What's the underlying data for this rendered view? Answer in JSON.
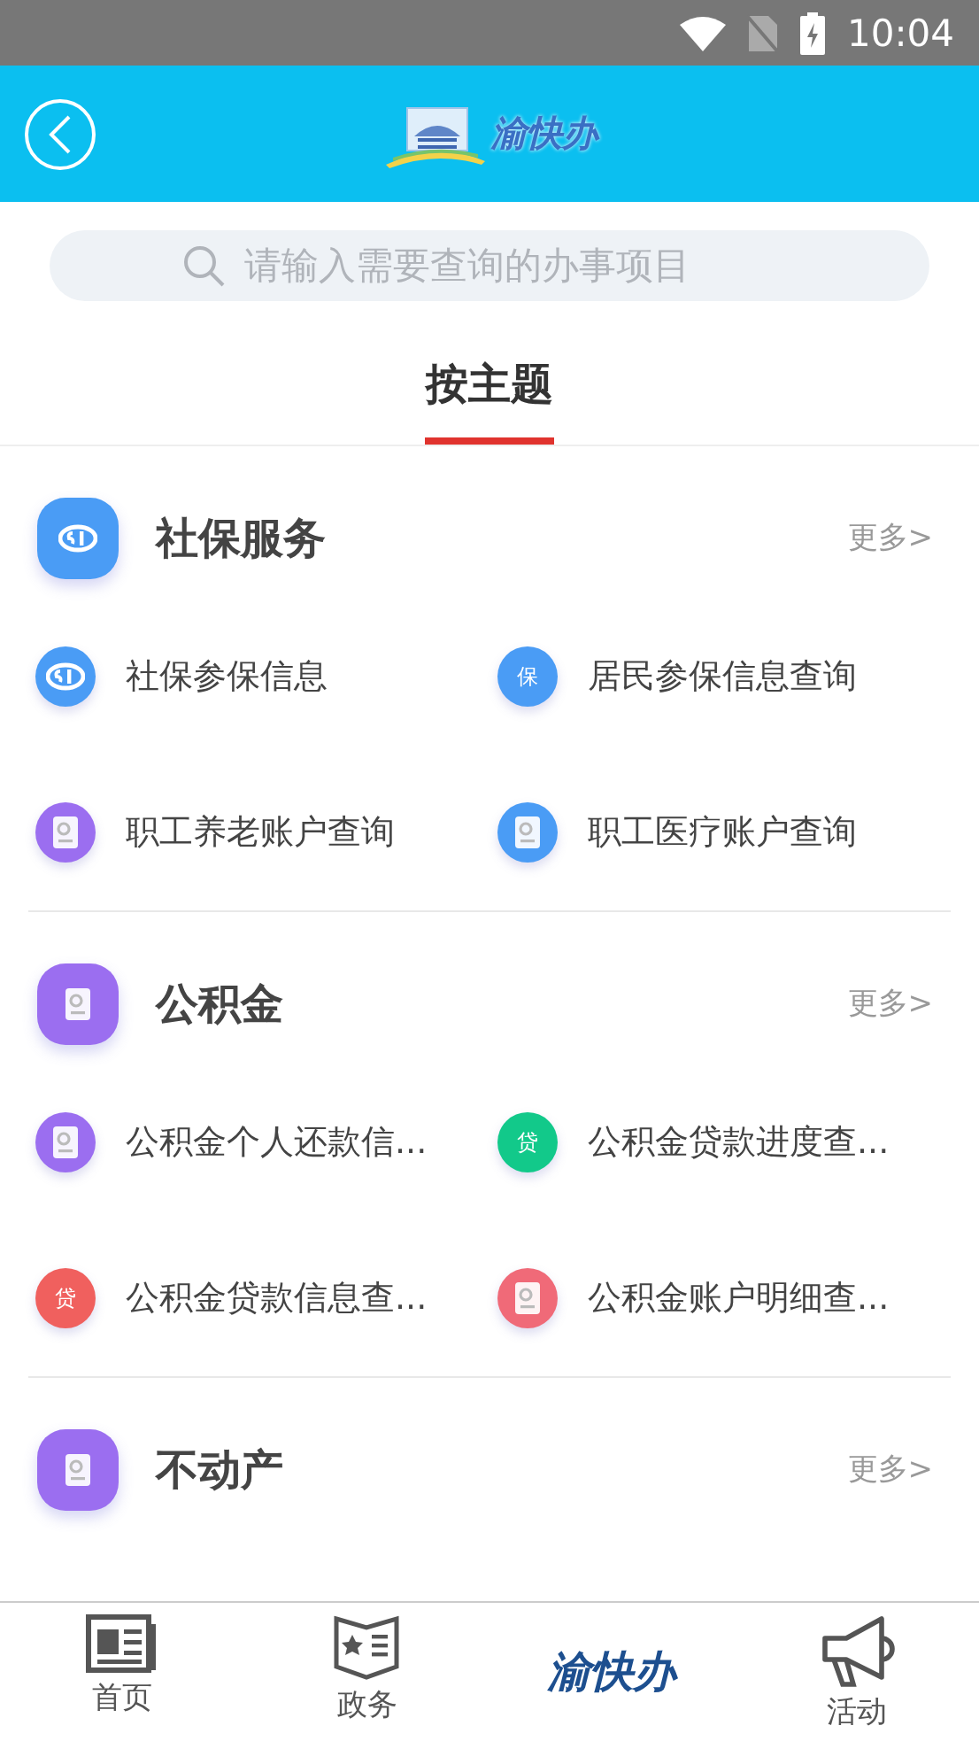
{
  "status_bar": {
    "time": "10:04"
  },
  "header": {
    "logo_text": "渝快办"
  },
  "search": {
    "placeholder": "请输入需要查询的办事项目"
  },
  "tabs": [
    {
      "label": "按主题",
      "selected": true
    }
  ],
  "sections": [
    {
      "title": "社保服务",
      "more": "更多>",
      "color": "#4a9cf5",
      "items": [
        {
          "label": "社保参保信息",
          "color": "#4a9cf5"
        },
        {
          "label": "居民参保信息查询",
          "color": "#4a9cf5",
          "icon_text": "保"
        },
        {
          "label": "职工养老账户查询",
          "color": "#9b6ef0"
        },
        {
          "label": "职工医疗账户查询",
          "color": "#4a9cf5"
        }
      ]
    },
    {
      "title": "公积金",
      "more": "更多>",
      "color": "#9b6ef0",
      "items": [
        {
          "label": "公积金个人还款信...",
          "color": "#9b6ef0"
        },
        {
          "label": "公积金贷款进度查...",
          "color": "#12c98a",
          "icon_text": "贷"
        },
        {
          "label": "公积金贷款信息查...",
          "color": "#f0605e",
          "icon_text": "贷"
        },
        {
          "label": "公积金账户明细查...",
          "color": "#f06a78"
        }
      ]
    },
    {
      "title": "不动产",
      "more": "更多>",
      "color": "#9b6ef0"
    }
  ],
  "bottom_nav": [
    {
      "kind": "tab",
      "label": "首页"
    },
    {
      "kind": "tab",
      "label": "政务"
    },
    {
      "kind": "logo",
      "label": "渝快办"
    },
    {
      "kind": "tab",
      "label": "活动"
    }
  ]
}
